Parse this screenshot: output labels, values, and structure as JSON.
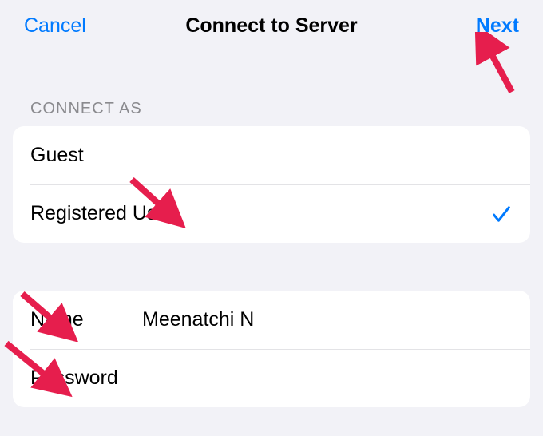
{
  "nav": {
    "cancel": "Cancel",
    "title": "Connect to Server",
    "next": "Next"
  },
  "connect_as": {
    "header": "CONNECT AS",
    "options": {
      "guest": "Guest",
      "registered": "Registered User"
    },
    "selected": "registered"
  },
  "credentials": {
    "name_label": "Name",
    "name_value": "Meenatchi N",
    "password_label": "Password",
    "password_value": ""
  },
  "colors": {
    "accent": "#007aff",
    "arrow": "#e61e4d"
  }
}
